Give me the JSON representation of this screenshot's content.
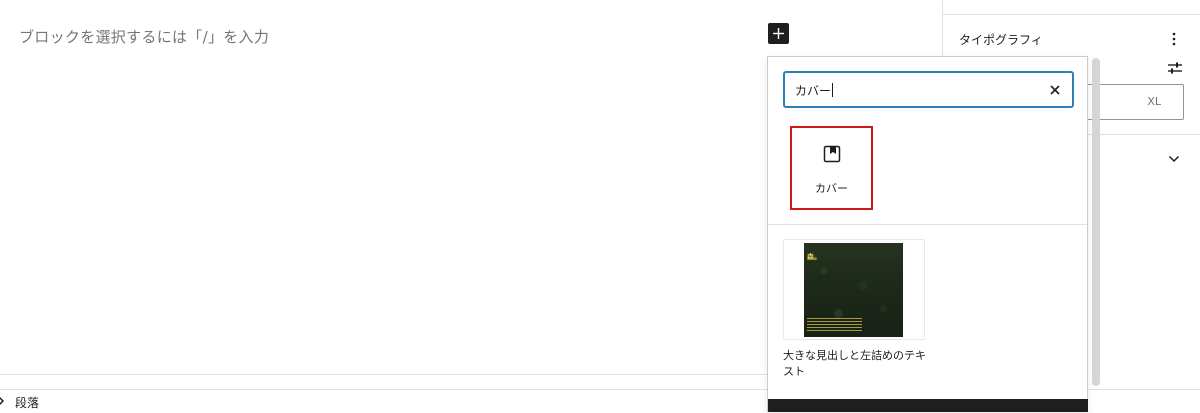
{
  "editor": {
    "placeholder": "ブロックを選択するには「/」を入力",
    "inserter_toggle": "plus-icon"
  },
  "sidebar": {
    "panel_title": "タイポグラフィ",
    "panel_menu_icon": "more-vertical-icon",
    "panel_options_icon": "sliders-icon",
    "font_size_selected": "XL",
    "collapsed_panel_icon": "chevron-down-icon"
  },
  "inserter": {
    "search": {
      "value": "カバー",
      "clear_icon": "close-icon"
    },
    "blocks": [
      {
        "label": "カバー",
        "icon": "cover-icon"
      }
    ],
    "patterns": [
      {
        "label": "大きな見出しと左詰めのテキスト",
        "thumb_title": "森。"
      }
    ]
  },
  "footer": {
    "breadcrumb": "段落"
  },
  "colors": {
    "accent": "#2f7fb5",
    "highlight": "#cc1818",
    "text": "#1e1e1e",
    "muted": "#757575"
  }
}
